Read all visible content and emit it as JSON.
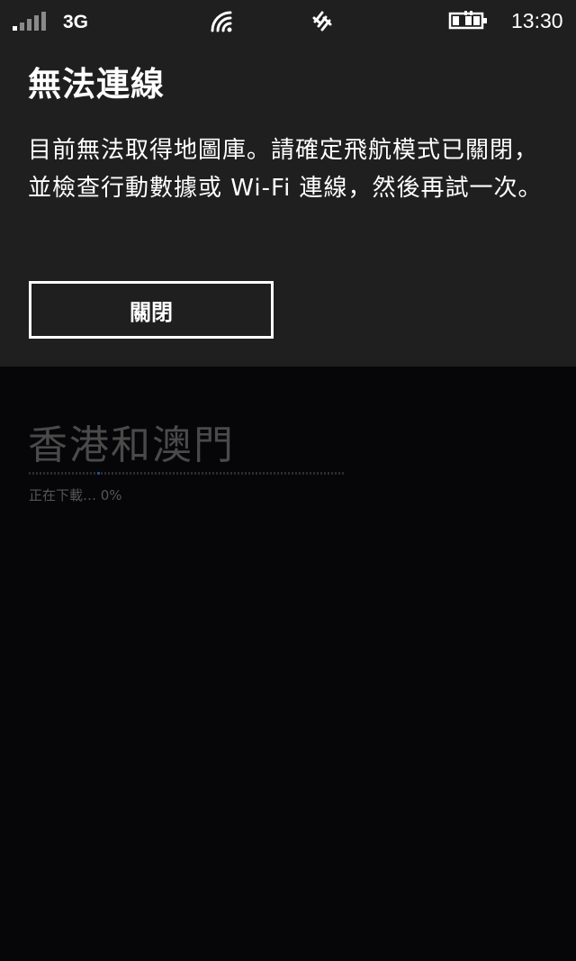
{
  "status_bar": {
    "signal_icon": "signal-strength-icon",
    "network_type": "3G",
    "wifi_icon": "wifi-icon",
    "nfc_icon": "nfc-icon",
    "battery_icon": "battery-charging-icon",
    "time": "13:30"
  },
  "dialog": {
    "title": "無法連線",
    "message": "目前無法取得地圖庫。請確定飛航模式已關閉，並檢查行動數據或 Wi-Fi 連線，然後再試一次。",
    "close_label": "關閉"
  },
  "download": {
    "region_name": "香港和澳門",
    "status_text": "正在下載… 0%",
    "progress": 0
  },
  "colors": {
    "dialog_background": "#1f1f1f",
    "page_background": "#060608",
    "dimmed_text": "#4a4a4a",
    "accent": "#1a4f8a"
  }
}
